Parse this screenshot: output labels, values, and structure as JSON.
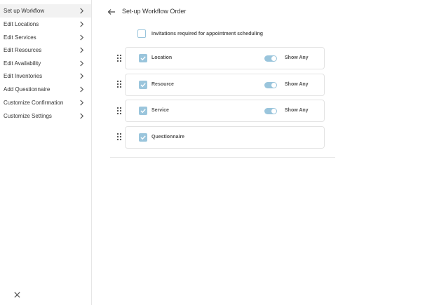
{
  "sidebar": {
    "items": [
      {
        "label": "Set up Workflow",
        "active": true
      },
      {
        "label": "Edit Locations",
        "active": false
      },
      {
        "label": "Edit Services",
        "active": false
      },
      {
        "label": "Edit Resources",
        "active": false
      },
      {
        "label": "Edit Availability",
        "active": false
      },
      {
        "label": "Edit Inventories",
        "active": false
      },
      {
        "label": "Add Questionnaire",
        "active": false
      },
      {
        "label": "Customize Confirmation",
        "active": false
      },
      {
        "label": "Customize Settings",
        "active": false
      }
    ],
    "close_icon": "close-icon"
  },
  "header": {
    "back_icon": "arrow-left-icon",
    "title": "Set-up Workflow Order"
  },
  "invitations": {
    "label": "Invitations required for appointment scheduling",
    "checked": false
  },
  "workflow": [
    {
      "label": "Location",
      "checked": true,
      "show_any": true,
      "toggle_label": "Show Any"
    },
    {
      "label": "Resource",
      "checked": true,
      "show_any": true,
      "toggle_label": "Show Any"
    },
    {
      "label": "Service",
      "checked": true,
      "show_any": true,
      "toggle_label": "Show Any"
    },
    {
      "label": "Questionnaire",
      "checked": true
    }
  ],
  "colors": {
    "accent": "#9ac5dc",
    "active_bg": "#f2f2f2",
    "border": "#e3e3e3"
  }
}
